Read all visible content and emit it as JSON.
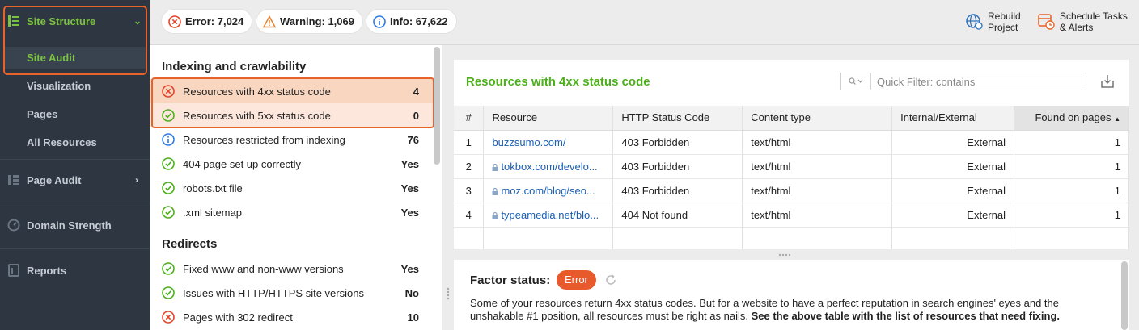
{
  "sidebar": {
    "site_structure": "Site Structure",
    "site_audit": "Site Audit",
    "visualization": "Visualization",
    "pages": "Pages",
    "all_resources": "All Resources",
    "page_audit": "Page Audit",
    "domain_strength": "Domain Strength",
    "reports": "Reports"
  },
  "topbar": {
    "error": "Error: 7,024",
    "warning": "Warning: 1,069",
    "info": "Info: 67,622",
    "rebuild_line1": "Rebuild",
    "rebuild_line2": "Project",
    "schedule_line1": "Schedule Tasks",
    "schedule_line2": "& Alerts"
  },
  "factors": {
    "section1": "Indexing and crawlability",
    "section2": "Redirects",
    "rows": [
      {
        "label": "Resources with 4xx status code",
        "value": "4",
        "status": "error"
      },
      {
        "label": "Resources with 5xx status code",
        "value": "0",
        "status": "ok"
      },
      {
        "label": "Resources restricted from indexing",
        "value": "76",
        "status": "info"
      },
      {
        "label": "404 page set up correctly",
        "value": "Yes",
        "status": "ok"
      },
      {
        "label": "robots.txt file",
        "value": "Yes",
        "status": "ok"
      },
      {
        "label": ".xml sitemap",
        "value": "Yes",
        "status": "ok"
      },
      {
        "label": "Fixed www and non-www versions",
        "value": "Yes",
        "status": "ok"
      },
      {
        "label": "Issues with HTTP/HTTPS site versions",
        "value": "No",
        "status": "ok"
      },
      {
        "label": "Pages with 302 redirect",
        "value": "10",
        "status": "error"
      }
    ]
  },
  "panel": {
    "title": "Resources with 4xx status code",
    "filter_placeholder": "Quick Filter: contains",
    "columns": [
      "#",
      "Resource",
      "HTTP Status Code",
      "Content type",
      "Internal/External",
      "Found on pages"
    ],
    "rows": [
      {
        "n": "1",
        "resource": "buzzsumo.com/",
        "lock": false,
        "status": "403 Forbidden",
        "type": "text/html",
        "ie": "External",
        "found": "1"
      },
      {
        "n": "2",
        "resource": "tokbox.com/develo...",
        "lock": true,
        "status": "403 Forbidden",
        "type": "text/html",
        "ie": "External",
        "found": "1"
      },
      {
        "n": "3",
        "resource": "moz.com/blog/seo...",
        "lock": true,
        "status": "403 Forbidden",
        "type": "text/html",
        "ie": "External",
        "found": "1"
      },
      {
        "n": "4",
        "resource": "typeamedia.net/blo...",
        "lock": true,
        "status": "404 Not found",
        "type": "text/html",
        "ie": "External",
        "found": "1"
      }
    ]
  },
  "factor_status": {
    "label": "Factor status:",
    "badge": "Error",
    "text": "Some of your resources return 4xx status codes. But for a website to have a perfect reputation in search engines' eyes and the unshakable #1 position, all resources must be right as nails.",
    "text_bold": "See the above table with the list of resources that need fixing."
  },
  "colors": {
    "sidebar_bg": "#2e3641",
    "accent_green": "#7cc242",
    "title_green": "#4caf1c",
    "error_red": "#e8592c",
    "highlight_orange": "#e8622c",
    "link_blue": "#1a5fb4"
  }
}
